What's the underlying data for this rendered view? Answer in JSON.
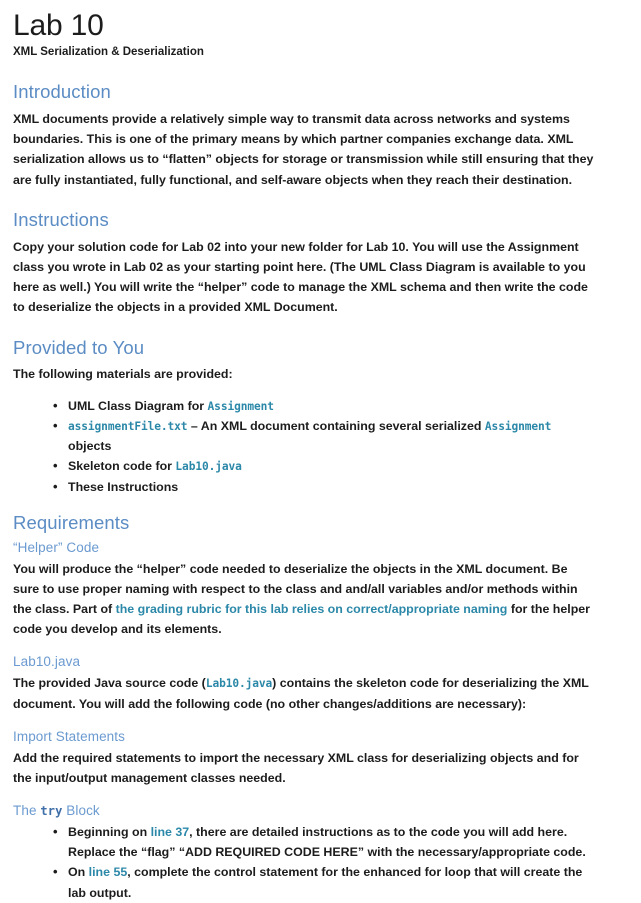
{
  "document": {
    "title": "Lab 10",
    "subtitle": "XML Serialization & Deserialization"
  },
  "introduction": {
    "heading": "Introduction",
    "paragraph": "XML documents provide a relatively simple way to transmit data across networks and systems boundaries. This is one of the primary means by which partner companies exchange data. XML serialization allows us to “flatten” objects for storage or transmission while still ensuring that they are fully instantiated, fully functional, and self-aware objects when they reach their destination."
  },
  "instructions": {
    "heading": "Instructions",
    "paragraph": "Copy your solution code for Lab 02 into your new folder for Lab 10. You will use the Assignment class you wrote in Lab 02 as your starting point here. (The UML Class Diagram is available to you here as well.) You will write the “helper” code to manage the XML schema and then write the code to deserialize the objects in a provided XML Document."
  },
  "provided": {
    "heading": "Provided to You",
    "intro": "The following materials are provided:",
    "items": [
      {
        "parts": [
          {
            "type": "text",
            "value": "UML Class Diagram for "
          },
          {
            "type": "code",
            "value": "Assignment"
          }
        ]
      },
      {
        "parts": [
          {
            "type": "code",
            "value": "assignmentFile.txt"
          },
          {
            "type": "text",
            "value": " – An XML document containing several serialized "
          },
          {
            "type": "code",
            "value": "Assignment"
          },
          {
            "type": "text",
            "value": " objects"
          }
        ]
      },
      {
        "parts": [
          {
            "type": "text",
            "value": "Skeleton code for "
          },
          {
            "type": "code",
            "value": "Lab10.java"
          }
        ]
      },
      {
        "parts": [
          {
            "type": "text",
            "value": "These Instructions"
          }
        ]
      }
    ]
  },
  "requirements": {
    "heading": "Requirements",
    "helper": {
      "subheading": "“Helper” Code",
      "paragraph_parts": [
        {
          "type": "text",
          "value": "You will produce the “helper” code needed to deserialize the objects in the XML document. Be sure to use proper naming with respect to the class and and/all variables and/or methods within the class. Part of "
        },
        {
          "type": "link",
          "value": "the grading rubric for this lab relies on correct/appropriate naming"
        },
        {
          "type": "text",
          "value": " for the helper code you develop and its elements."
        }
      ]
    },
    "lab10java": {
      "subheading": "Lab10.java",
      "paragraph_parts": [
        {
          "type": "text",
          "value": "The provided Java source code ("
        },
        {
          "type": "code",
          "value": "Lab10.java"
        },
        {
          "type": "text",
          "value": ") contains the skeleton code for deserializing the XML document. You will add the following code (no other changes/additions are necessary):"
        }
      ]
    },
    "imports": {
      "subheading": "Import Statements",
      "paragraph": "Add the required statements to import the necessary XML class for deserializing objects and for the input/output management classes needed."
    },
    "try_block": {
      "subheading_parts": [
        {
          "type": "text",
          "value": "The "
        },
        {
          "type": "code-try",
          "value": "try"
        },
        {
          "type": "text",
          "value": " Block"
        }
      ],
      "items": [
        {
          "parts": [
            {
              "type": "text",
              "value": "Beginning on "
            },
            {
              "type": "link",
              "value": "line 37"
            },
            {
              "type": "text",
              "value": ", there are detailed instructions as to the code you will add here. Replace the “flag” “ADD REQUIRED CODE HERE” with the necessary/appropriate code."
            }
          ]
        },
        {
          "parts": [
            {
              "type": "text",
              "value": "On "
            },
            {
              "type": "link",
              "value": "line 55"
            },
            {
              "type": "text",
              "value": ", complete the control statement for the enhanced for loop that will create the lab output."
            }
          ]
        }
      ]
    }
  },
  "colors": {
    "heading_blue": "#5b8cc4",
    "subheading_blue": "#6b9ad0",
    "code_teal": "#2b88a8",
    "try_blue": "#3f6ea8",
    "body_text": "#1c1c1c"
  }
}
